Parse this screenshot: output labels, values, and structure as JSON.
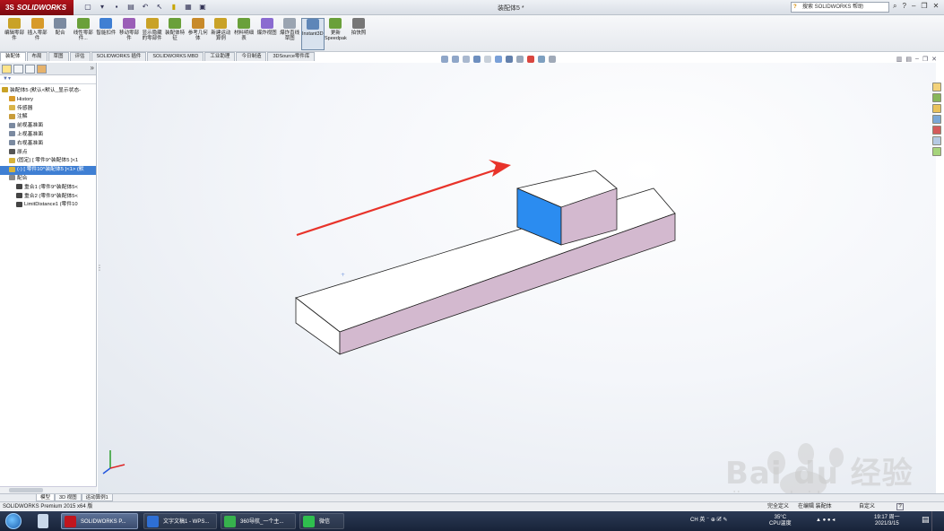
{
  "app": {
    "brand": "SOLIDWORKS",
    "brand_prefix": "3S",
    "document_title": "装配体5 *",
    "help_search_placeholder": "搜索 SOLIDWORKS 帮助"
  },
  "command_manager": {
    "buttons": [
      {
        "label": "编辑零部件",
        "icon": "edit-component-icon"
      },
      {
        "label": "插入零部件",
        "icon": "insert-component-icon"
      },
      {
        "label": "配合",
        "icon": "mate-icon"
      },
      {
        "label": "线性零部件...",
        "icon": "linear-pattern-icon"
      },
      {
        "label": "智能扣件",
        "icon": "smart-fastener-icon"
      },
      {
        "label": "移动零部件",
        "icon": "move-component-icon"
      },
      {
        "label": "显示隐藏的零部件",
        "icon": "show-hidden-icon"
      },
      {
        "label": "装配体特征",
        "icon": "assembly-feature-icon"
      },
      {
        "label": "参考几何体",
        "icon": "reference-geometry-icon"
      },
      {
        "label": "新建运动算例",
        "icon": "motion-study-icon"
      },
      {
        "label": "材料明细表",
        "icon": "bom-icon"
      },
      {
        "label": "爆炸视图",
        "icon": "exploded-view-icon"
      },
      {
        "label": "爆炸直线草图",
        "icon": "explode-line-icon"
      },
      {
        "label": "Instant3D",
        "icon": "instant3d-icon",
        "active": true
      },
      {
        "label": "更新Speedpak",
        "icon": "speedpak-icon"
      },
      {
        "label": "拍快照",
        "icon": "snapshot-icon"
      }
    ]
  },
  "tabs": [
    "装配体",
    "布局",
    "草图",
    "评估",
    "SOLIDWORKS 插件",
    "SOLIDWORKS MBD",
    "工业助理",
    "今日制造",
    "3DSource零件库"
  ],
  "active_tab": 0,
  "feature_tree": {
    "filter_label": "▼▾",
    "items": [
      {
        "label": "装配体5 (默认<默认_显示状态-",
        "indent": 0,
        "color": "#c9a227"
      },
      {
        "label": "History",
        "indent": 1,
        "color": "#d79a2a"
      },
      {
        "label": "传感器",
        "indent": 1,
        "color": "#d9b44a"
      },
      {
        "label": "注解",
        "indent": 1,
        "color": "#c89c3a"
      },
      {
        "label": "前视基准面",
        "indent": 1,
        "color": "#7b8aa0"
      },
      {
        "label": "上视基准面",
        "indent": 1,
        "color": "#7b8aa0"
      },
      {
        "label": "右视基准面",
        "indent": 1,
        "color": "#7b8aa0"
      },
      {
        "label": "原点",
        "indent": 1,
        "color": "#555555"
      },
      {
        "label": "(固定) [ 零件9^装配体5 ]<1",
        "indent": 1,
        "color": "#d7b33a"
      },
      {
        "label": "(-) [ 零件10^装配体5 ]<1> (默",
        "indent": 1,
        "color": "#d7b33a",
        "selected": true
      },
      {
        "label": "配合",
        "indent": 1,
        "color": "#8a8a8a"
      },
      {
        "label": "重合1 (零件9^装配体5<",
        "indent": 2,
        "color": "#444444"
      },
      {
        "label": "重合2 (零件9^装配体5<",
        "indent": 2,
        "color": "#444444"
      },
      {
        "label": "LimitDistance1 (零件10",
        "indent": 2,
        "color": "#444444"
      }
    ]
  },
  "bottom_tabs": [
    "模型",
    "3D 视图",
    "运动算例1"
  ],
  "status_bar": {
    "left": "SOLIDWORKS Premium 2015 x64 版",
    "r1": "完全定义",
    "r2": "在编辑 装配体",
    "r3": "自定义",
    "help": "?"
  },
  "taskbar": {
    "apps": [
      {
        "label": "SOLIDWORKS P...",
        "icon": "solidworks-icon",
        "active": true
      },
      {
        "label": "文字文稿1 - WPS...",
        "icon": "wps-icon",
        "active": false
      },
      {
        "label": "360导航_一个主...",
        "icon": "browser-360-icon",
        "active": false
      },
      {
        "label": "微信",
        "icon": "wechat-icon",
        "active": false
      }
    ],
    "tray_ime": "CH 英 ⁻ ⊕ 🗹 ✎",
    "temperature": "35°C",
    "temperature_label": "CPU温度",
    "time": "19:17 周一",
    "date": "2021/3/15"
  },
  "watermark": {
    "brand": "Bai du 经验",
    "url": "jingyan.baidu.com"
  },
  "colors": {
    "selected_face": "#2b8cf0",
    "side_face": "#d3b9cf",
    "top_face": "#ffffff",
    "arrow": "#e8332a",
    "selection": "#3f7fd3"
  }
}
